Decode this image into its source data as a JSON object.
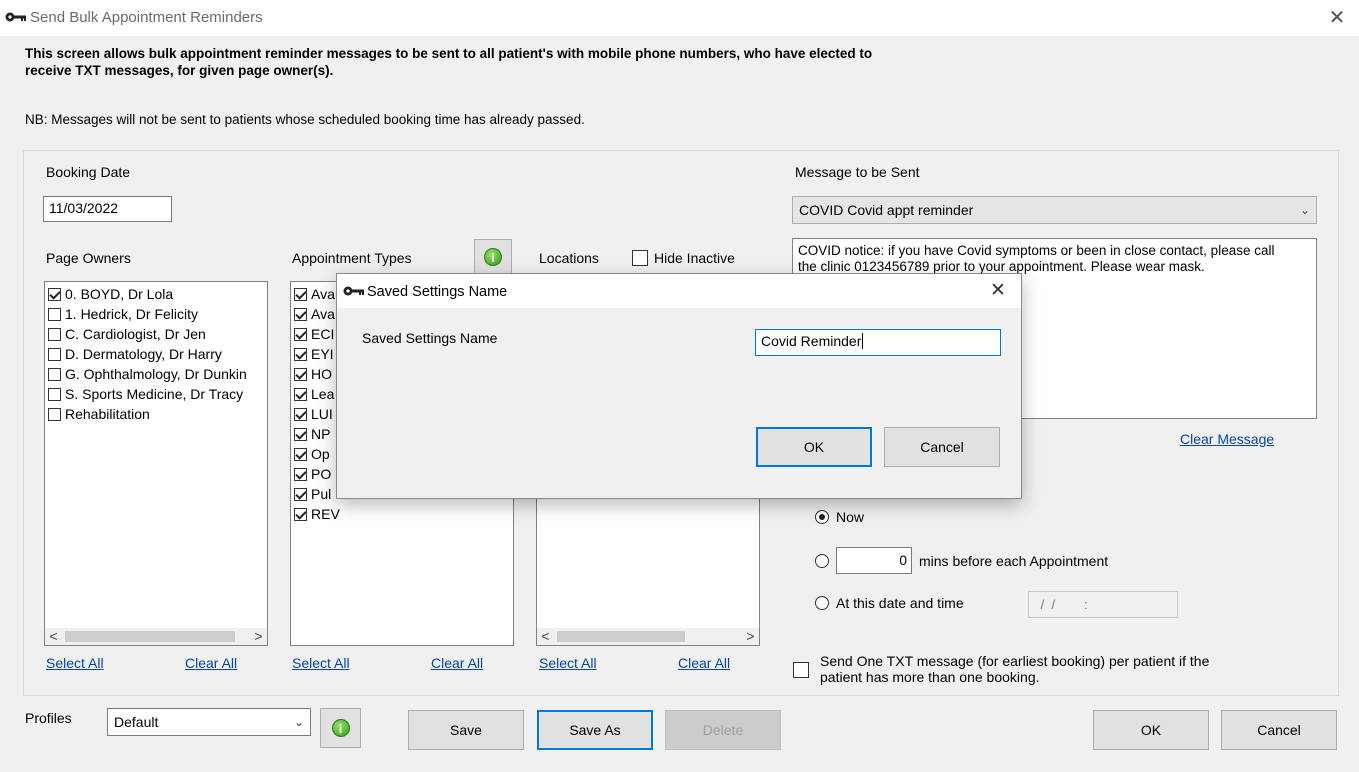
{
  "window": {
    "title": "Send Bulk Appointment Reminders",
    "close_glyph": "✕",
    "icon": "key-icon"
  },
  "intro": {
    "line1": "This screen allows bulk appointment reminder messages to be sent to all patient's with mobile phone numbers, who have elected to",
    "line2": "receive TXT messages, for given page owner(s).",
    "note": "NB: Messages will not be sent  to patients whose scheduled booking time has already passed."
  },
  "booking": {
    "label": "Booking Date",
    "value": "11/03/2022"
  },
  "page_owners": {
    "label": "Page Owners",
    "items": [
      {
        "label": "0. BOYD, Dr Lola",
        "checked": true
      },
      {
        "label": "1. Hedrick, Dr Felicity",
        "checked": false
      },
      {
        "label": "C. Cardiologist, Dr Jen",
        "checked": false
      },
      {
        "label": "D. Dermatology, Dr Harry",
        "checked": false
      },
      {
        "label": "G. Ophthalmology, Dr Dunkin",
        "checked": false
      },
      {
        "label": "S. Sports Medicine, Dr Tracy",
        "checked": false
      },
      {
        "label": "Rehabilitation",
        "checked": false
      }
    ],
    "select_all": "Select All",
    "clear_all": "Clear All"
  },
  "appointment_types": {
    "label": "Appointment Types",
    "items": [
      {
        "label": "Ava",
        "checked": true
      },
      {
        "label": "Ava",
        "checked": true
      },
      {
        "label": "ECI",
        "checked": true
      },
      {
        "label": "EYI",
        "checked": true
      },
      {
        "label": "HO",
        "checked": true
      },
      {
        "label": "Lea",
        "checked": true
      },
      {
        "label": "LUI",
        "checked": true
      },
      {
        "label": "NP",
        "checked": true
      },
      {
        "label": "Op",
        "checked": true
      },
      {
        "label": "PO",
        "checked": true
      },
      {
        "label": "Pul",
        "checked": true
      },
      {
        "label": "REV",
        "checked": true
      }
    ],
    "select_all": "Select All",
    "clear_all": "Clear All"
  },
  "locations": {
    "label": "Locations",
    "hide_inactive": "Hide Inactive",
    "select_all": "Select All",
    "clear_all": "Clear All"
  },
  "message": {
    "label": "Message to be Sent",
    "selected": "COVID Covid appt reminder",
    "text_line1": "COVID notice: if you have Covid symptoms or been in close contact, please call",
    "text_line2": "the clinic 0123456789 prior to your appointment. Please wear mask.",
    "clear": "Clear Message"
  },
  "schedule": {
    "now": "Now",
    "mins_value": "0",
    "mins_label": "mins before each Appointment",
    "at_label": "At this date and time",
    "datetime_placeholder": " /  /        :"
  },
  "send_one": {
    "line1": "Send One TXT message (for earliest booking) per patient if the",
    "line2": "patient has more than one booking."
  },
  "profiles": {
    "label": "Profiles",
    "selected": "Default"
  },
  "buttons": {
    "save": "Save",
    "save_as": "Save As",
    "delete": "Delete",
    "ok": "OK",
    "cancel": "Cancel"
  },
  "dialog": {
    "title": "Saved Settings Name",
    "field_label": "Saved Settings Name",
    "field_value": "Covid Reminder",
    "ok": "OK",
    "cancel": "Cancel",
    "close_glyph": "✕"
  },
  "scroll": {
    "left": "<",
    "right": ">"
  },
  "info_glyph": "i"
}
